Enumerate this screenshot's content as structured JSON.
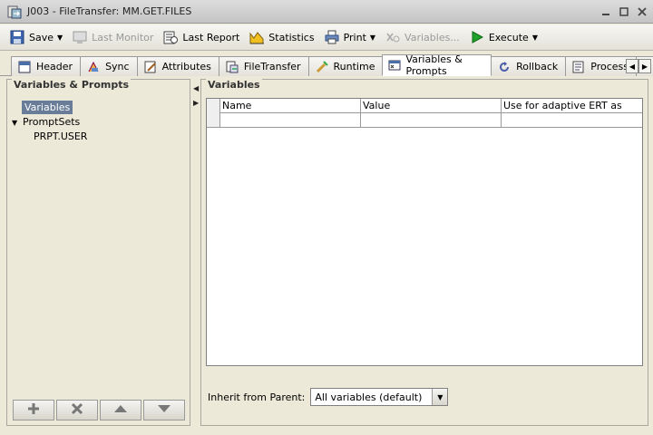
{
  "window": {
    "title": "J003 - FileTransfer: MM.GET.FILES"
  },
  "toolbar": {
    "save_label": "Save",
    "last_monitor_label": "Last Monitor",
    "last_report_label": "Last Report",
    "statistics_label": "Statistics",
    "print_label": "Print",
    "variables_label": "Variables...",
    "execute_label": "Execute"
  },
  "tabs": [
    {
      "label": "Header",
      "icon": "header-icon"
    },
    {
      "label": "Sync",
      "icon": "sync-icon"
    },
    {
      "label": "Attributes",
      "icon": "attributes-icon"
    },
    {
      "label": "FileTransfer",
      "icon": "filetransfer-icon"
    },
    {
      "label": "Runtime",
      "icon": "runtime-icon"
    },
    {
      "label": "Variables & Prompts",
      "icon": "variables-icon"
    },
    {
      "label": "Rollback",
      "icon": "rollback-icon"
    },
    {
      "label": "Process",
      "icon": "process-icon"
    }
  ],
  "left_panel": {
    "title": "Variables & Prompts",
    "tree": {
      "variables": "Variables",
      "promptsets": "PromptSets",
      "promptset_child": "PRPT.USER"
    }
  },
  "right_panel": {
    "title": "Variables",
    "columns": [
      "Name",
      "Value",
      "Use for adaptive ERT as"
    ],
    "inherit_label": "Inherit from Parent:",
    "inherit_value": "All variables (default)"
  },
  "colors": {
    "selection": "#6a7d98",
    "execute_green": "#1fa12a"
  }
}
